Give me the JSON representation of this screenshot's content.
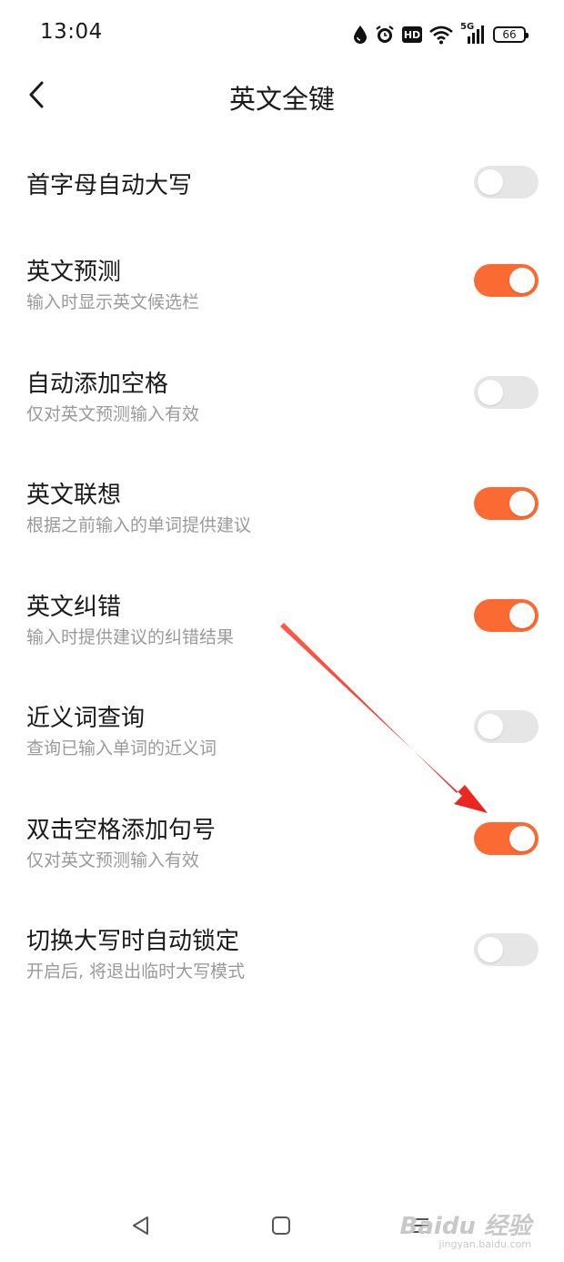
{
  "status_bar": {
    "time": "13:04",
    "network": "5G",
    "hd": "HD",
    "battery": "66",
    "icons": [
      "water-drop-icon",
      "alarm-icon",
      "hd-icon",
      "wifi-icon",
      "signal-5g-icon",
      "battery-icon"
    ]
  },
  "header": {
    "title": "英文全键",
    "back_icon": "chevron-left-icon"
  },
  "settings": [
    {
      "title": "首字母自动大写",
      "subtitle": "",
      "enabled": false
    },
    {
      "title": "英文预测",
      "subtitle": "输入时显示英文候选栏",
      "enabled": true
    },
    {
      "title": "自动添加空格",
      "subtitle": "仅对英文预测输入有效",
      "enabled": false
    },
    {
      "title": "英文联想",
      "subtitle": "根据之前输入的单词提供建议",
      "enabled": true
    },
    {
      "title": "英文纠错",
      "subtitle": "输入时提供建议的纠错结果",
      "enabled": true
    },
    {
      "title": "近义词查询",
      "subtitle": "查询已输入单词的近义词",
      "enabled": false
    },
    {
      "title": "双击空格添加句号",
      "subtitle": "仅对英文预测输入有效",
      "enabled": true
    },
    {
      "title": "切换大写时自动锁定",
      "subtitle": "开启后, 将退出临时大写模式",
      "enabled": false
    }
  ],
  "colors": {
    "toggle_on": "#fb6a32",
    "toggle_off": "#e6e6e6",
    "annotation_arrow": "#e8231d"
  },
  "nav_bar": {
    "icons": [
      "back-triangle-icon",
      "home-square-icon",
      "menu-lines-icon"
    ]
  },
  "watermark": {
    "text": "Baidu 经验",
    "url": "jingyan.baidu.com"
  }
}
